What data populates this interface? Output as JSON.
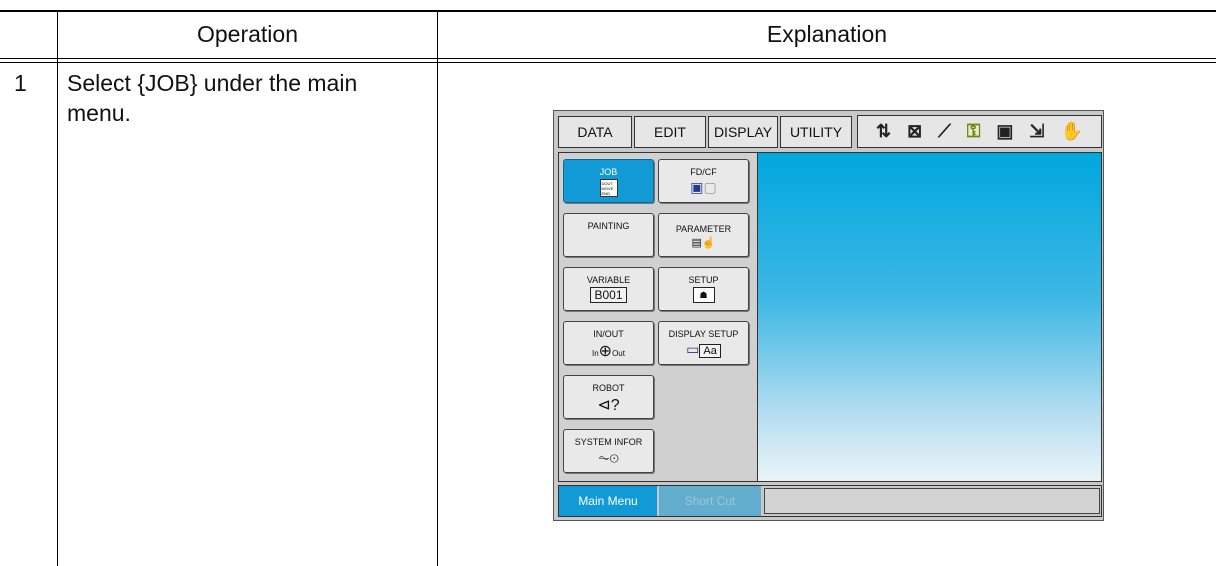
{
  "table": {
    "headers": {
      "operation": "Operation",
      "explanation": "Explanation"
    },
    "rows": [
      {
        "step": "1",
        "operation": "Select {JOB} under the main menu."
      }
    ]
  },
  "screen": {
    "top_tabs": [
      "DATA",
      "EDIT",
      "DISPLAY",
      "UTILITY"
    ],
    "status_icons": [
      "axis-icon",
      "sigma-icon",
      "robot-arm-icon",
      "key-icon",
      "card-icon",
      "export-icon",
      "hand-icon"
    ],
    "menu": {
      "job": {
        "label": "JOB",
        "icon_lines": [
          "DOUT",
          "MOVE",
          "END"
        ]
      },
      "fdcf": {
        "label": "FD/CF"
      },
      "painting": {
        "label": "PAINTING"
      },
      "parameter": {
        "label": "PARAMETER"
      },
      "variable": {
        "label": "VARIABLE",
        "icon_text": "B001"
      },
      "setup": {
        "label": "SETUP"
      },
      "inout": {
        "label": "IN/OUT",
        "in_text": "In",
        "out_text": "Out"
      },
      "display_setup": {
        "label": "DISPLAY SETUP",
        "icon_text": "Aa"
      },
      "robot": {
        "label": "ROBOT"
      },
      "system_info": {
        "label": "SYSTEM INFOR"
      }
    },
    "bottom": {
      "main_menu": "Main Menu",
      "short_cut": "Short Cut"
    },
    "colors": {
      "accent": "#119ad6",
      "gradient_top": "#00a7de"
    }
  }
}
